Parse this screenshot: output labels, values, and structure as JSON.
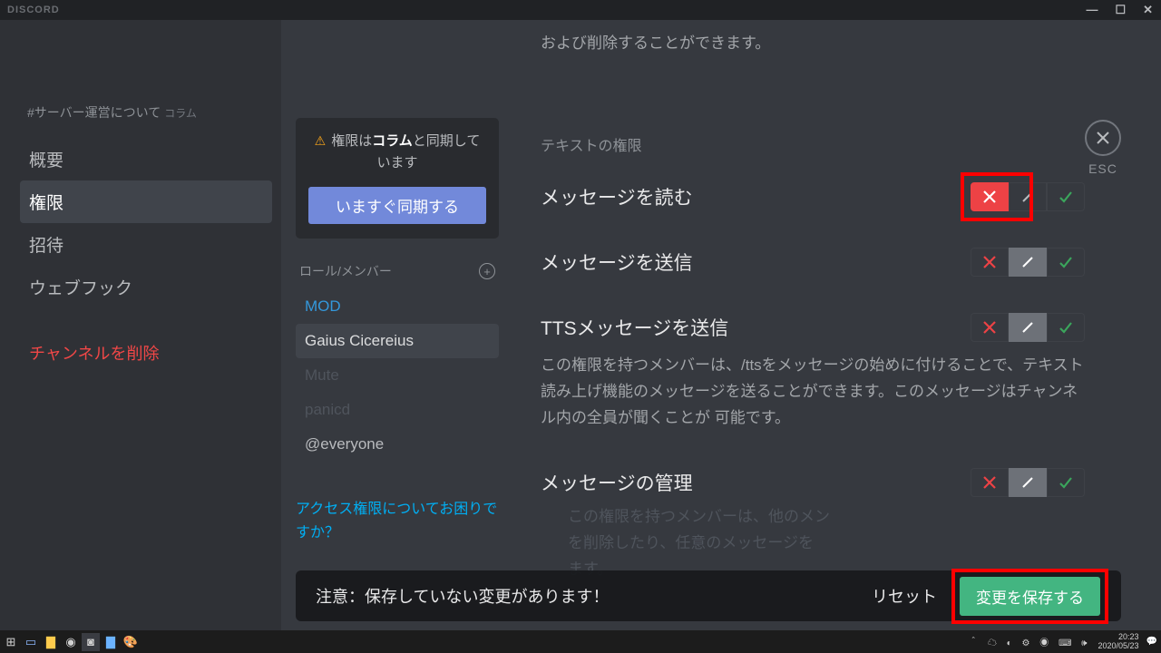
{
  "titlebar": {
    "appname": "DISCORD"
  },
  "sidebar": {
    "channel_prefix": "#",
    "channel_name": "サーバー運営について",
    "channel_sub": "コラム",
    "items": [
      "概要",
      "権限",
      "招待",
      "ウェブフック"
    ],
    "delete": "チャンネルを削除"
  },
  "sync": {
    "text_pre": "権限は",
    "text_bold": "コラム",
    "text_post": "と同期しています",
    "button": "いますぐ同期する"
  },
  "roles": {
    "header": "ロール/メンバー",
    "list": [
      "MOD",
      "Gaius Cicereius",
      "Mute",
      "panicd",
      "@everyone"
    ]
  },
  "help_link": "アクセス権限についてお困りですか？",
  "top_remnant": "および削除することができます。",
  "section_label": "テキストの権限",
  "perms": {
    "read": {
      "title": "メッセージを読む"
    },
    "send": {
      "title": "メッセージを送信"
    },
    "tts": {
      "title": "TTSメッセージを送信",
      "desc": "この権限を持つメンバーは、/ttsをメッセージの始めに付けることで、テキスト読み上げ機能のメッセージを送ることができます。このメッセージはチャンネル内の全員が聞くことが 可能です。"
    },
    "manage": {
      "title": "メッセージの管理",
      "desc_faded1": "この権限を持つメンバーは、他のメン",
      "desc_faded2": "を削除したり、任意のメッセージを",
      "desc_faded3": "ます。"
    }
  },
  "savebar": {
    "msg": "注意：保存していない変更があります！",
    "reset": "リセット",
    "save": "変更を保存する"
  },
  "esc": "ESC",
  "taskbar": {
    "time": "20:23",
    "date": "2020/05/23"
  }
}
